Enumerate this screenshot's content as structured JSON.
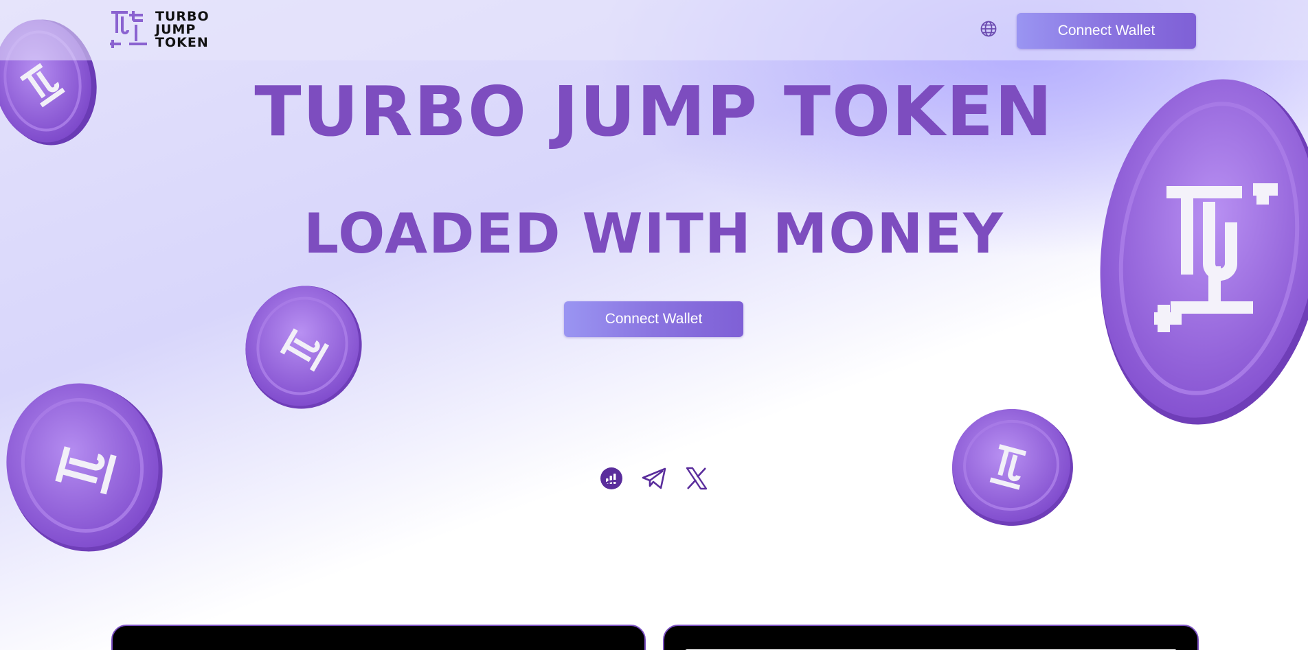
{
  "brand": {
    "logo_lines": [
      "TURBO",
      "JUMP",
      "TOKEN"
    ],
    "accent": "#7d4dbf",
    "button_gradient": [
      "#9a95f2",
      "#7f60d6"
    ]
  },
  "header": {
    "language_icon": "globe-icon",
    "connect_label": "Connect Wallet"
  },
  "hero": {
    "title": "TURBO JUMP TOKEN",
    "subtitle": "LOADED WITH MONEY",
    "connect_label": "Connect Wallet"
  },
  "socials": [
    {
      "icon": "dexscreener-icon"
    },
    {
      "icon": "telegram-icon"
    },
    {
      "icon": "x-twitter-icon"
    }
  ],
  "decor": {
    "coin_icon": "coin-icon",
    "coin_color": "#8e5fd6"
  }
}
